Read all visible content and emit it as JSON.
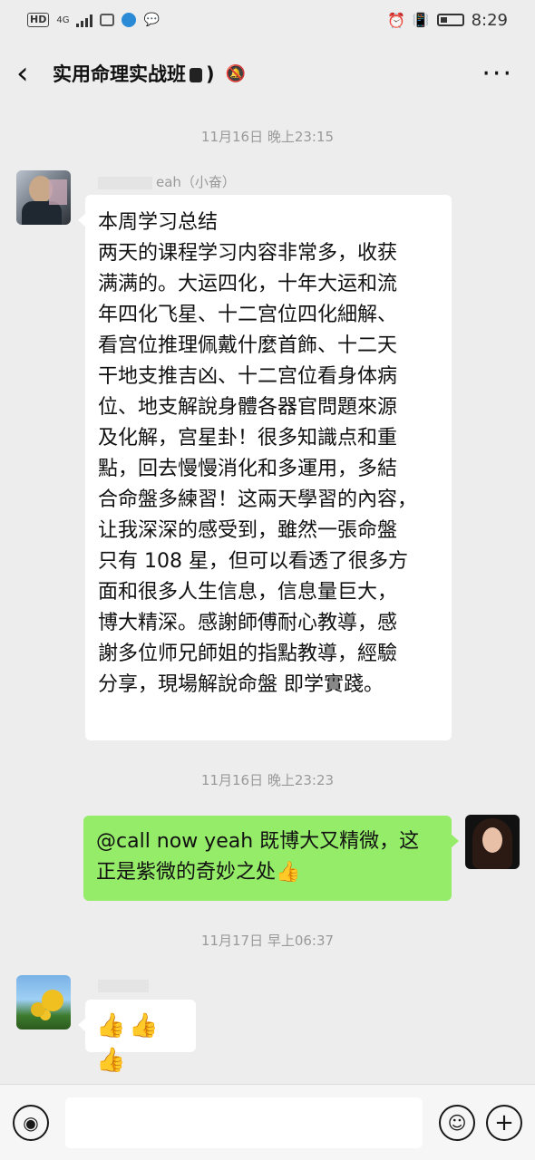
{
  "status_bar": {
    "network": "HD",
    "signal": "4G",
    "time": "8:29"
  },
  "header": {
    "back_icon": "chevron-left",
    "title": "实用命理实战班",
    "title_suffix": ")",
    "mute_icon": "bell-muted",
    "more_label": "···"
  },
  "messages": [
    {
      "type": "timestamp",
      "text": "11月16日 晚上23:15"
    },
    {
      "type": "incoming",
      "sender": "eah（小奋）",
      "lines": [
        "本周学习总结",
        "两天的课程学习内容非常多，收获",
        "满满的。大运四化，十年大运和流",
        "年四化飞星、十二宫位四化細解、",
        "看宫位推理佩戴什麼首飾、十二天",
        "干地支推吉凶、十二宫位看身体病",
        "位、地支解說身體各器官問題來源",
        "及化解，宫星卦！很多知識点和重",
        "點，回去慢慢消化和多運用，多結",
        "合命盤多練習！这兩天學習的內容，",
        "让我深深的感受到，雖然一張命盤",
        "只有 108 星，但可以看透了很多方",
        "面和很多人生信息，信息量巨大，",
        "博大精深。感謝師傅耐心教導，感",
        "謝多位师兄師姐的指點教導，經驗",
        "分享，現場解說命盤 即学實踐。"
      ]
    },
    {
      "type": "timestamp",
      "text": "11月16日 晚上23:23"
    },
    {
      "type": "outgoing",
      "lines": [
        "@call now yeah  既博大又精微，这",
        "正是紫微的奇妙之处👍"
      ]
    },
    {
      "type": "timestamp",
      "text": "11月17日 早上06:37"
    },
    {
      "type": "incoming",
      "sender": "",
      "text": "👍👍👍"
    }
  ],
  "input_bar": {
    "voice_icon": "voice",
    "emoji_icon": "emoji-smile",
    "plus_icon": "plus"
  }
}
